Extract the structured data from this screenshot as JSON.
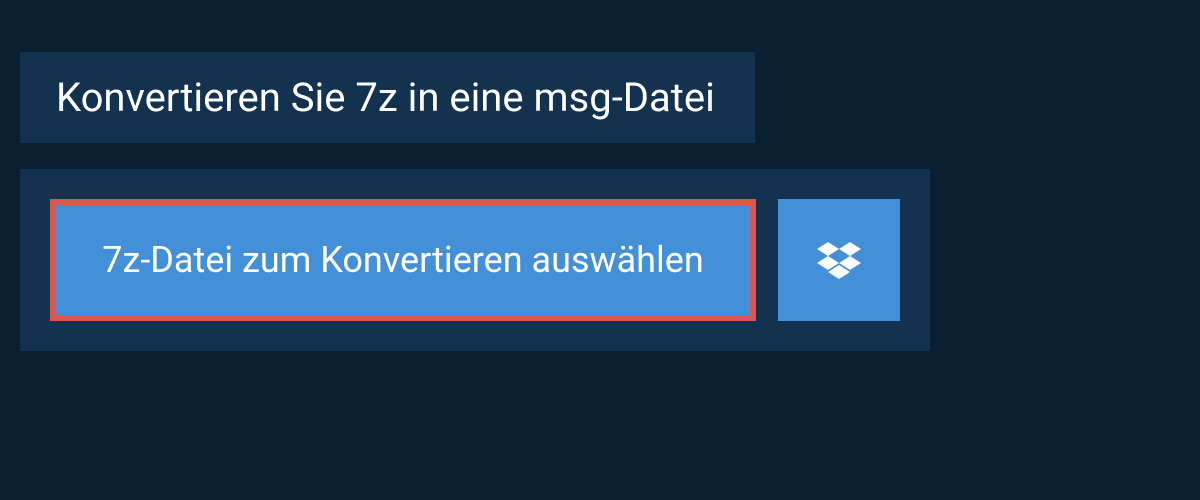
{
  "header": {
    "title": "Konvertieren Sie 7z in eine msg-Datei"
  },
  "upload": {
    "select_file_label": "7z-Datei zum Konvertieren auswählen"
  },
  "colors": {
    "background": "#0b1f33",
    "panel": "#12324f",
    "button": "#4390d9",
    "highlight_border": "#d9574f",
    "text": "#ffffff"
  }
}
